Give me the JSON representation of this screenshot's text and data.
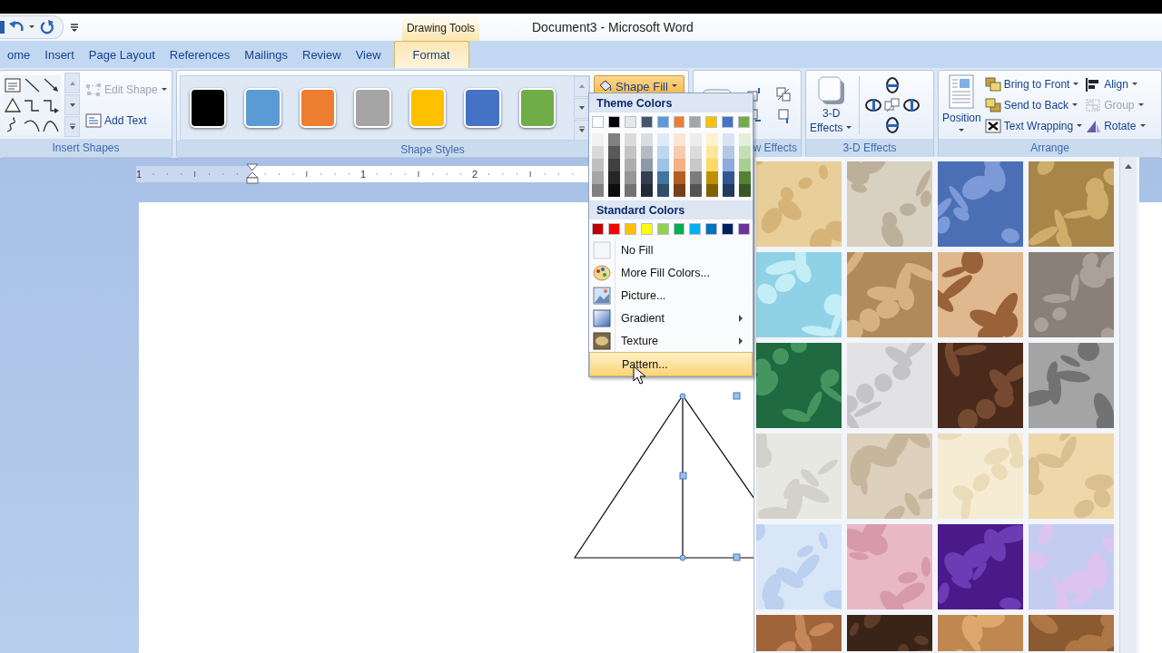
{
  "window": {
    "title": "Document3 - Microsoft Word",
    "contextual_tab": "Drawing Tools"
  },
  "tabs": [
    {
      "label": "ome",
      "selected": false
    },
    {
      "label": "Insert",
      "selected": false
    },
    {
      "label": "Page Layout",
      "selected": false
    },
    {
      "label": "References",
      "selected": false
    },
    {
      "label": "Mailings",
      "selected": false
    },
    {
      "label": "Review",
      "selected": false
    },
    {
      "label": "View",
      "selected": false
    },
    {
      "label": "Format",
      "selected": true
    }
  ],
  "insert_shapes": {
    "label": "Insert Shapes",
    "commands": [
      {
        "label": "Edit Shape",
        "disabled": true
      },
      {
        "label": "Add Text",
        "disabled": false
      }
    ]
  },
  "shape_styles": {
    "label": "Shape Styles",
    "styles": [
      {
        "color": "#000000"
      },
      {
        "color": "#5b9bd5"
      },
      {
        "color": "#ed7d31"
      },
      {
        "color": "#a5a5a5"
      },
      {
        "color": "#ffc000"
      },
      {
        "color": "#4472c4"
      },
      {
        "color": "#70ad47"
      }
    ],
    "shape_fill": {
      "label": "Shape Fill",
      "expanded": true
    }
  },
  "shadow_effects": {
    "label": "w Effects"
  },
  "three_d_effects": {
    "label": "3-D Effects",
    "button_lines": [
      "3-D",
      "Effects"
    ]
  },
  "arrange": {
    "label": "Arrange",
    "position": "Position",
    "commands": [
      {
        "label": "Bring to Front",
        "disabled": false
      },
      {
        "label": "Send to Back",
        "disabled": false
      },
      {
        "label": "Text Wrapping",
        "disabled": false
      },
      {
        "label": "Align",
        "disabled": false
      },
      {
        "label": "Group",
        "disabled": true
      },
      {
        "label": "Rotate",
        "disabled": false
      }
    ]
  },
  "ruler": {
    "labels": [
      "1",
      "1",
      "2"
    ]
  },
  "fill_menu": {
    "theme_heading": "Theme Colors",
    "theme_colors": [
      {
        "color": "#ffffff"
      },
      {
        "color": "#000000"
      },
      {
        "color": "#e7e6e6"
      },
      {
        "color": "#44546a"
      },
      {
        "color": "#5b9bd5"
      },
      {
        "color": "#ed7d31"
      },
      {
        "color": "#a5a5a5"
      },
      {
        "color": "#ffc000"
      },
      {
        "color": "#4472c4"
      },
      {
        "color": "#70ad47"
      }
    ],
    "standard_heading": "Standard Colors",
    "standard_colors": [
      {
        "color": "#c00000"
      },
      {
        "color": "#ff0000"
      },
      {
        "color": "#ffc000"
      },
      {
        "color": "#ffff00"
      },
      {
        "color": "#92d050"
      },
      {
        "color": "#00b050"
      },
      {
        "color": "#00b0f0"
      },
      {
        "color": "#0070c0"
      },
      {
        "color": "#002060"
      },
      {
        "color": "#7030a0"
      }
    ],
    "items": [
      {
        "label": "No Fill",
        "kind": "nofill",
        "submenu": false,
        "selected": false
      },
      {
        "label": "More Fill Colors...",
        "kind": "colors",
        "submenu": false,
        "selected": false
      },
      {
        "label": "Picture...",
        "kind": "picture",
        "submenu": false,
        "selected": false
      },
      {
        "label": "Gradient",
        "kind": "gradient",
        "submenu": true,
        "selected": false
      },
      {
        "label": "Texture",
        "kind": "texture",
        "submenu": true,
        "selected": false
      },
      {
        "label": "Pattern...",
        "kind": "pattern",
        "submenu": false,
        "selected": true
      }
    ]
  }
}
